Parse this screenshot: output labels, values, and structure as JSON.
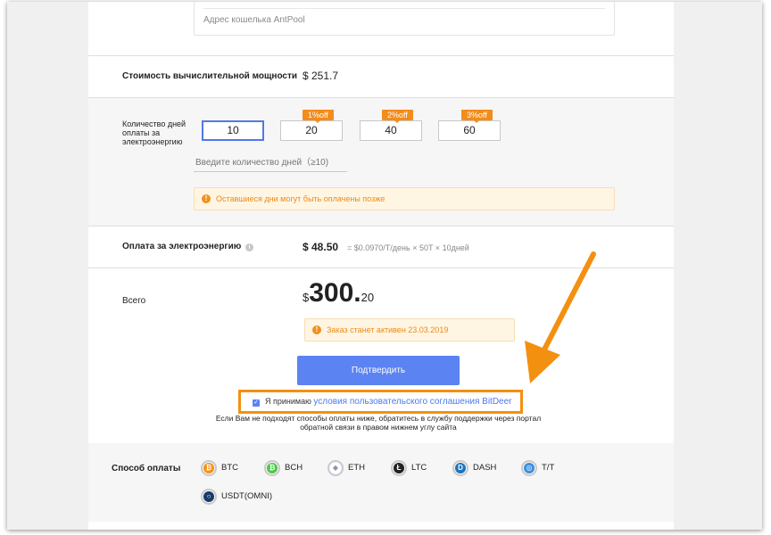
{
  "wallet": {
    "placeholder": "Адрес кошелька AntPool"
  },
  "hashrate_cost": {
    "label": "Стоимость вычислительной мощности",
    "value": "$ 251.7"
  },
  "days": {
    "label_line1": "Количество дней",
    "label_line2": "оплаты за",
    "label_line3": "электроэнергию",
    "options": [
      {
        "value": "10",
        "badge": ""
      },
      {
        "value": "20",
        "badge": "1%off"
      },
      {
        "value": "40",
        "badge": "2%off"
      },
      {
        "value": "60",
        "badge": "3%off"
      }
    ],
    "selected": "10",
    "input_placeholder": "Введите количество дней（≥10)",
    "notice": "Оставшиеся дни могут быть оплачены позже"
  },
  "electricity": {
    "label": "Оплата за электроэнергию",
    "amount": "$ 48.50",
    "formula": "= $0.0970/T/день × 50T × 10дней"
  },
  "total": {
    "label": "Всего",
    "currency": "$",
    "integer": "300.",
    "decimal": "20",
    "notice": "Заказ станет активен 23.03.2019"
  },
  "confirm": {
    "label": "Подтвердить"
  },
  "agreement": {
    "text": "Я принимаю ",
    "link": "условия пользовательского соглашения BitDeer",
    "checked": true
  },
  "help": {
    "line1": "Если Вам не подходят способы оплаты ниже, обратитесь в службу поддержки через портал",
    "line2": "обратной связи в правом нижнем углу сайта"
  },
  "payment": {
    "label": "Способ оплаты",
    "methods": [
      "BTC",
      "BCH",
      "ETH",
      "LTC",
      "DASH",
      "T/T",
      "USDT(OMNI)"
    ]
  },
  "colors": {
    "accent": "#5b83f1",
    "highlight": "#f4900f",
    "badge": "#f38c1a",
    "btc": "#f7931a",
    "bch": "#4cc947",
    "eth": "#8a92b2",
    "ltc": "#222222",
    "dash": "#1c75bc",
    "tt": "#3b8ee0",
    "usdt": "#26a17b"
  }
}
